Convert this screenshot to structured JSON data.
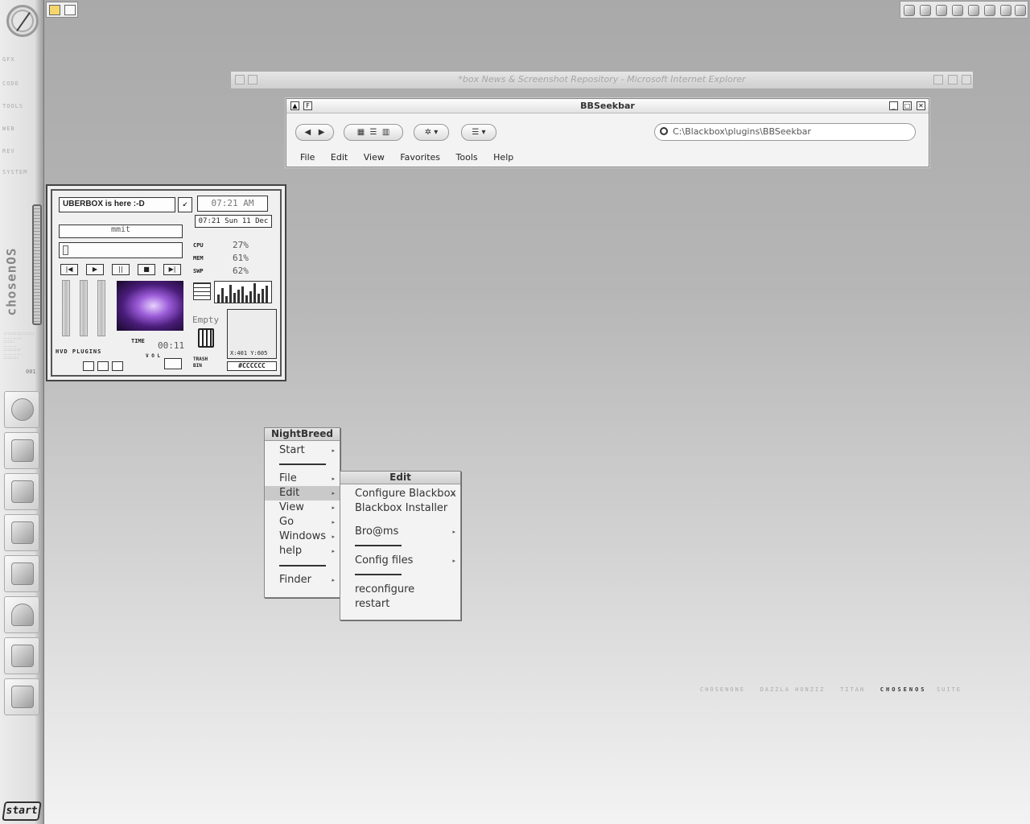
{
  "sidebar": {
    "links": [
      "GFX",
      "CODE",
      "TOOLS",
      "WEB",
      "REV",
      "SYSTEM"
    ],
    "brand": "chosenOS",
    "number": "001",
    "dock_icons": [
      "ie-icon",
      "mail-icon",
      "calculator-icon",
      "notepad-icon",
      "paint-icon",
      "user-icon",
      "printer-icon",
      "clipboard-icon"
    ],
    "start_label": "start"
  },
  "ie_window": {
    "title": "*box News & Screenshot Repository - Microsoft Internet Explorer"
  },
  "seekbar": {
    "title": "BBSeekbar",
    "address": "C:\\Blackbox\\plugins\\BBSeekbar",
    "menu": [
      "File",
      "Edit",
      "View",
      "Favorites",
      "Tools",
      "Help"
    ]
  },
  "widget": {
    "status": "UBERBOX is here :-D",
    "player_title": "mmit",
    "clock": "07:21 AM",
    "date": "07:21 Sun 11 Dec",
    "cpu_label": "CPU",
    "cpu": "27%",
    "mem_label": "MEM",
    "mem": "61%",
    "swp_label": "SWP",
    "swp": "62%",
    "trash_state": "Empty",
    "trash_label": "TRASH BIN",
    "coords": "X:401 Y:605",
    "color": "#CCCCCC",
    "plugins": "HVD PLUGINS",
    "time_label": "TIME",
    "time": "00:11",
    "vol_label": "V O L"
  },
  "menu_main": {
    "title": "NightBreed",
    "items": [
      "Start",
      "File",
      "Edit",
      "View",
      "Go",
      "Windows",
      "help",
      "Finder"
    ]
  },
  "menu_edit": {
    "title": "Edit",
    "items": [
      "Configure Blackbox",
      "Blackbox Installer",
      "Bro@ms",
      "Config files",
      "reconfigure",
      "restart"
    ]
  },
  "footer": {
    "items": [
      "CHOSENONE",
      "DAZZLA",
      "HONZIZ",
      "TITAN"
    ],
    "brand": "CHOSENOS",
    "suite": "SUITE"
  },
  "colors": {
    "accent": "#333333",
    "menu_bg": "#f3f3f3",
    "selection": "#c9c9c9"
  }
}
